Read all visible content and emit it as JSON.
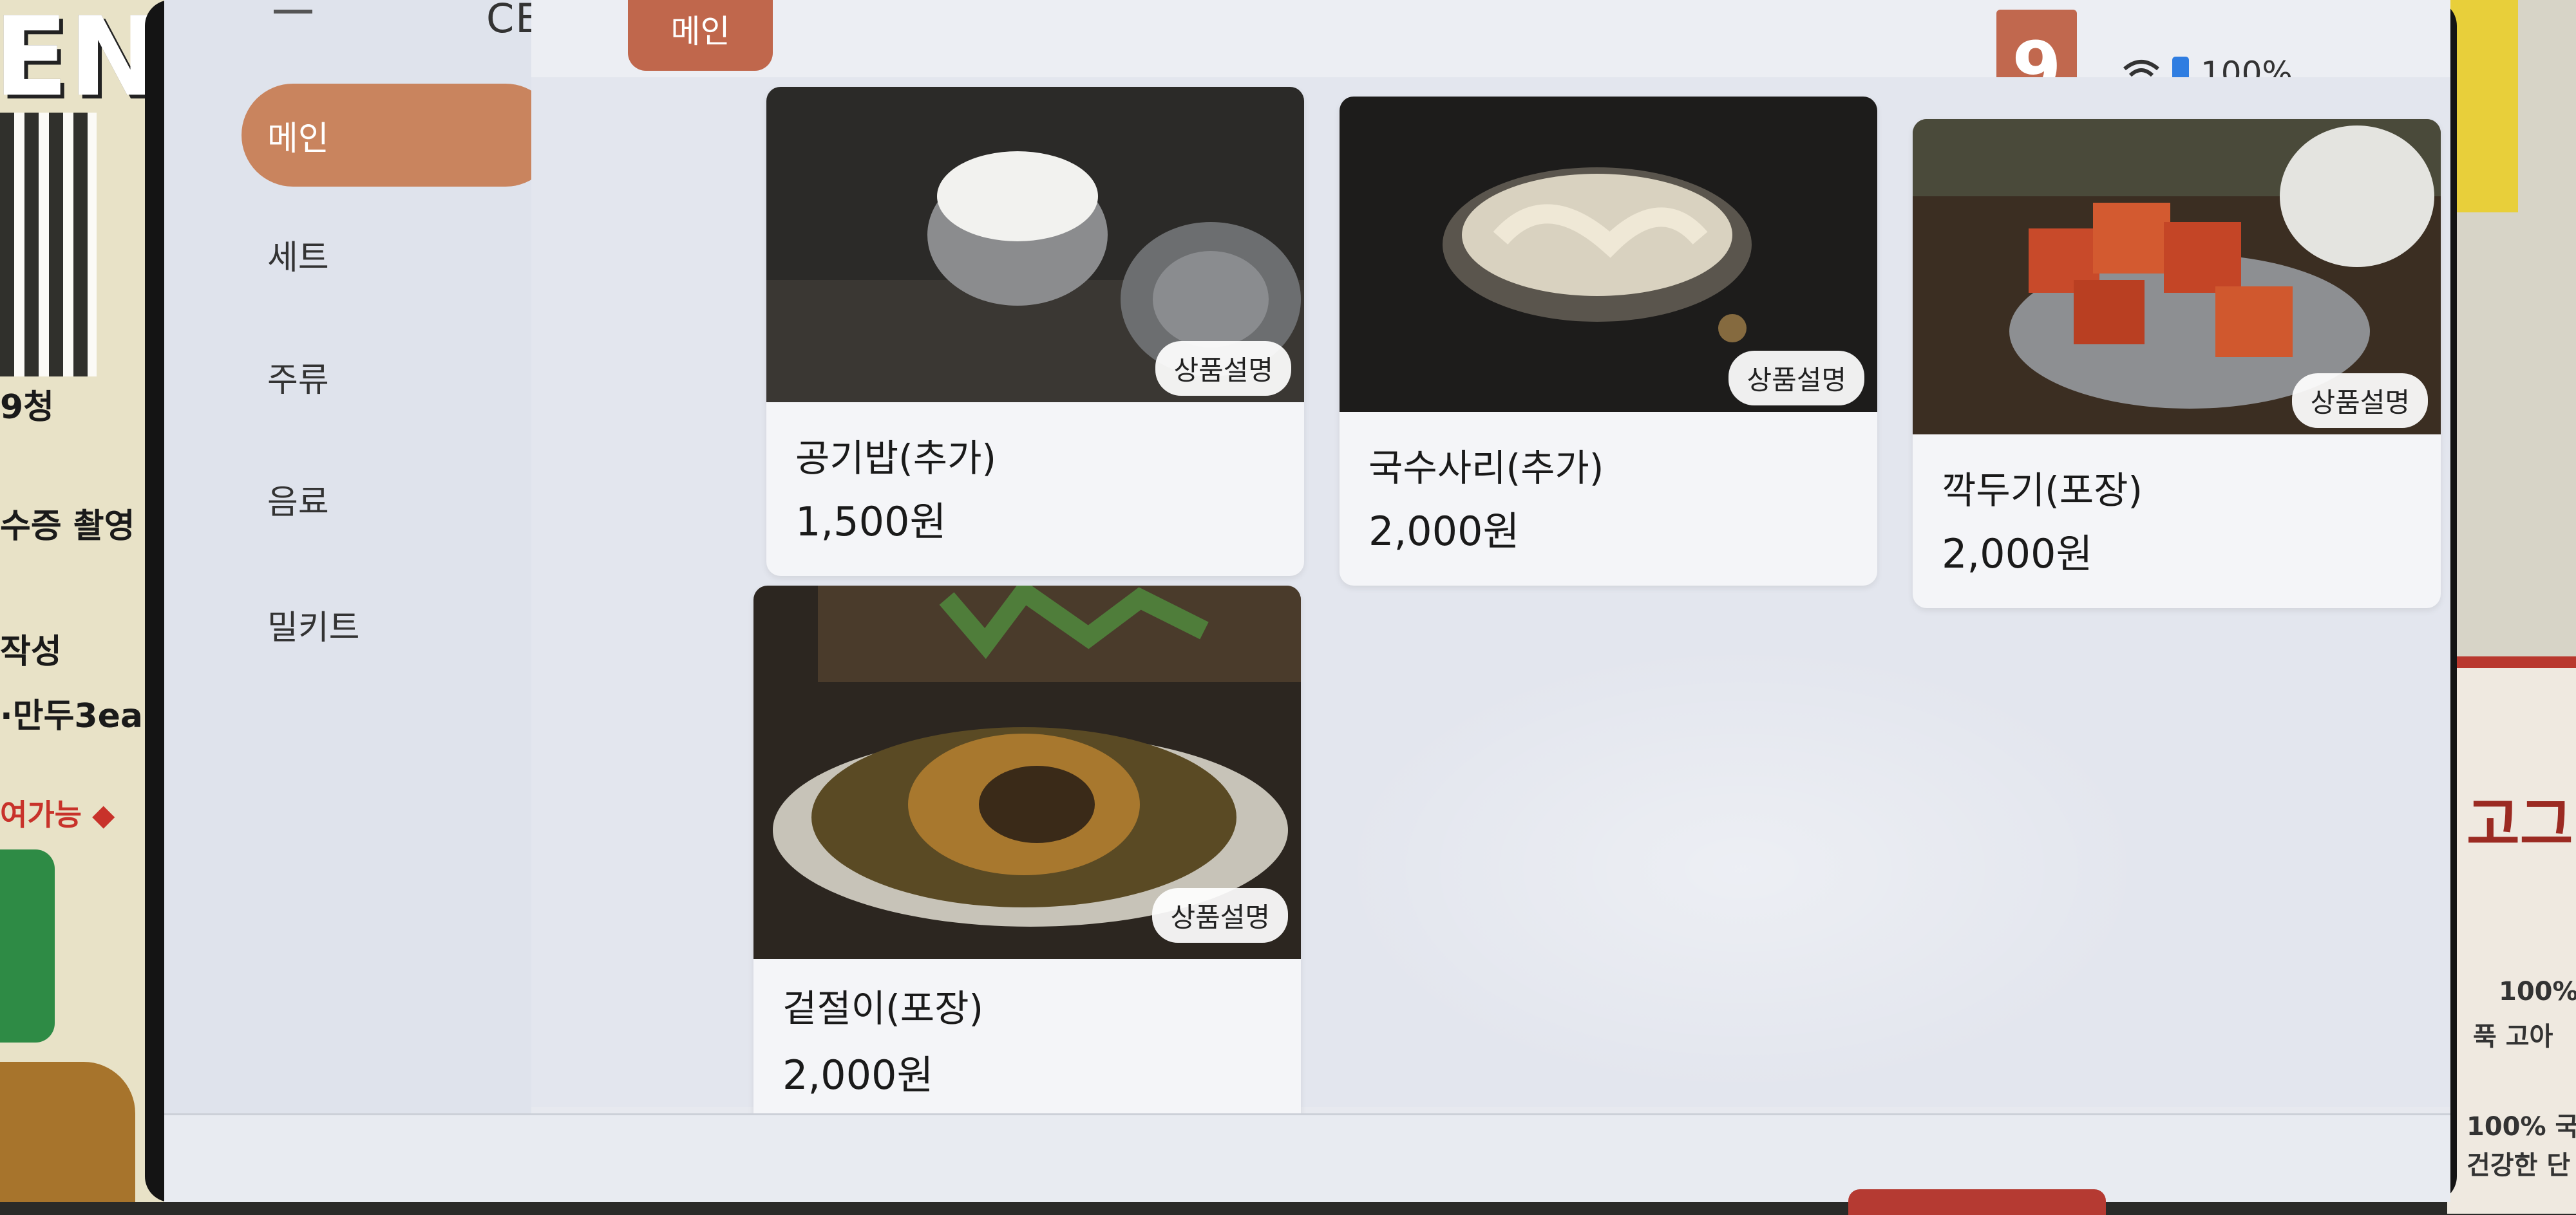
{
  "poster": {
    "headline": "ENT",
    "line1": "9청",
    "line2": "수증 촬영",
    "line3": "작성",
    "line4": "·만두3ea",
    "line5": "여가능 ◆"
  },
  "right_poster": {
    "text1": "고그",
    "text2": "100%",
    "text3": "푹 고아",
    "text4": "100% 국",
    "text5": "건강한 단"
  },
  "sidebar": {
    "logo": "CE",
    "items": [
      {
        "label": "메인"
      },
      {
        "label": "세트"
      },
      {
        "label": "주류"
      },
      {
        "label": "음료"
      },
      {
        "label": "밀키트"
      }
    ]
  },
  "header": {
    "active_tab": "메인",
    "table_number": "9",
    "battery": "100%"
  },
  "products": [
    {
      "name": "공기밥(추가)",
      "price": "1,500원",
      "desc_button": "상품설명",
      "image": "rice-bowl-photo"
    },
    {
      "name": "국수사리(추가)",
      "price": "2,000원",
      "desc_button": "상품설명",
      "image": "noodles-photo"
    },
    {
      "name": "깍두기(포장)",
      "price": "2,000원",
      "desc_button": "상품설명",
      "image": "kkakdugi-photo"
    },
    {
      "name": "겉절이(포장)",
      "price": "2,000원",
      "desc_button": "상품설명",
      "image": "geotjeori-photo"
    }
  ],
  "colors": {
    "accent": "#c0674c",
    "sidebar_active": "#c9845e",
    "battery": "#2f7de1"
  }
}
